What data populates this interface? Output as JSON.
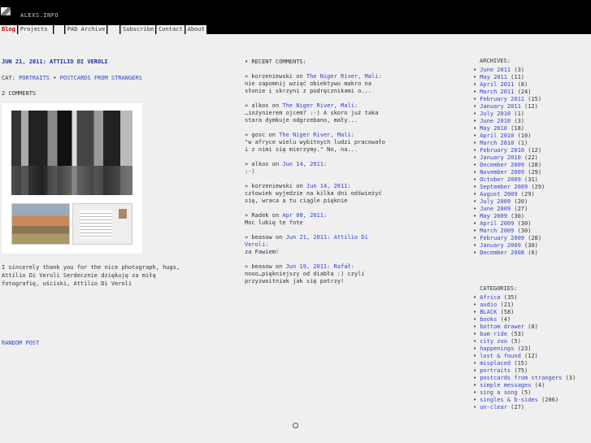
{
  "site": {
    "title": "ALEXS.INFO"
  },
  "nav": {
    "items": [
      "Blog",
      "Projects ",
      "",
      "PAD Archive",
      "",
      "Subscribe",
      "Contact",
      "About"
    ]
  },
  "post": {
    "title": "JUN 21, 2011: ATTILIO DI VEROLI",
    "cat_label": "CAT:",
    "cat1": "PORTRAITS",
    "cat_sep": "•",
    "cat2": "POSTCARDS FROM STRANGERS",
    "comments": "2 COMMENTS",
    "text": "I sincerely thank you for the nice photograph, hugs, Attilio Di Veroli Serdecznie dziękuję za miłą fotografię, uściski, Attilio Di Veroli",
    "random": "RANDOM POST"
  },
  "recent": {
    "heading": "• RECENT COMMENTS:",
    "items": [
      {
        "author": "» korzeniewski",
        "on": " on ",
        "link": "The Niger River, Mali",
        "colon": ":",
        "text": "nie zapomnij wziąć obiektywu makro na słonie i skrzyni z podręcznikami o..."
      },
      {
        "author": "» alkos",
        "on": " on ",
        "link": "The Niger River, Mali",
        "colon": ":",
        "text": "…inżynierem ojcem? :-) A skoro już taka stara dymkuje odgrzebano, mały..."
      },
      {
        "author": "» gosc",
        "on": " on ",
        "link": "The Niger River, Mali",
        "colon": ":",
        "text": "\"w afryce wielu wybitnych ludzi pracowało i z nimi się mierzymy.\" No, na..."
      },
      {
        "author": "» alkos",
        "on": " on ",
        "link": "Jun 14, 2011",
        "colon": ":",
        "text": ":-)"
      },
      {
        "author": "» korzeniewski",
        "on": " on ",
        "link": "Jun 14, 2011",
        "colon": ":",
        "text": "człowiek wyjedzie na kilka dni odświeżyć się, wraca a tu ciągle pięknie"
      },
      {
        "author": "» Radek",
        "on": " on ",
        "link": "Apr 08, 2011",
        "colon": ":",
        "text": "Moc lubię te fote"
      },
      {
        "author": "» beasow",
        "on": " on ",
        "link": "Jun 21, 2011: Attilio Di Veroli",
        "colon": ":",
        "text": "za Fawiem!"
      },
      {
        "author": "» beasow",
        "on": " on ",
        "link": "Jun 19, 2011: Rafał",
        "colon": ":",
        "text": "nooo…piękniejszy od diabła :) czyli przyzwoitniak jak się patrzy!"
      }
    ]
  },
  "archives": {
    "heading": "ARCHIVES:",
    "items": [
      {
        "label": "June 2011",
        "count": "(3)"
      },
      {
        "label": "May 2011",
        "count": "(11)"
      },
      {
        "label": "April 2011",
        "count": "(8)"
      },
      {
        "label": "March 2011",
        "count": "(24)"
      },
      {
        "label": "February 2011",
        "count": "(15)"
      },
      {
        "label": "January 2011",
        "count": "(12)"
      },
      {
        "label": "July 2010",
        "count": "(1)"
      },
      {
        "label": "June 2010",
        "count": "(3)"
      },
      {
        "label": "May 2010",
        "count": "(18)"
      },
      {
        "label": "April 2010",
        "count": "(10)"
      },
      {
        "label": "March 2010",
        "count": "(1)"
      },
      {
        "label": "February 2010",
        "count": "(12)"
      },
      {
        "label": "January 2010",
        "count": "(22)"
      },
      {
        "label": "December 2009",
        "count": "(28)"
      },
      {
        "label": "November 2009",
        "count": "(29)"
      },
      {
        "label": "October 2009",
        "count": "(31)"
      },
      {
        "label": "September 2009",
        "count": "(29)"
      },
      {
        "label": "August 2009",
        "count": "(29)"
      },
      {
        "label": "July 2009",
        "count": "(20)"
      },
      {
        "label": "June 2009",
        "count": "(27)"
      },
      {
        "label": "May 2009",
        "count": "(30)"
      },
      {
        "label": "April 2009",
        "count": "(30)"
      },
      {
        "label": "March 2009",
        "count": "(30)"
      },
      {
        "label": "February 2009",
        "count": "(28)"
      },
      {
        "label": "January 2009",
        "count": "(30)"
      },
      {
        "label": "December 2008",
        "count": "(6)"
      }
    ]
  },
  "categories": {
    "heading": "CATEGORIES:",
    "items": [
      {
        "label": "Africa",
        "count": "(35)"
      },
      {
        "label": "audio",
        "count": "(21)"
      },
      {
        "label": "BLACK",
        "count": "(58)"
      },
      {
        "label": "books",
        "count": "(4)"
      },
      {
        "label": "bottom drawer",
        "count": "(8)"
      },
      {
        "label": "bum ride",
        "count": "(53)"
      },
      {
        "label": "city zoo",
        "count": "(5)"
      },
      {
        "label": "happenings",
        "count": "(23)"
      },
      {
        "label": "lost & found",
        "count": "(12)"
      },
      {
        "label": "misplaced",
        "count": "(15)"
      },
      {
        "label": "portraits",
        "count": "(75)"
      },
      {
        "label": "postcards from strangers",
        "count": "(3)"
      },
      {
        "label": "simple messages",
        "count": "(4)"
      },
      {
        "label": "sing a song",
        "count": "(5)"
      },
      {
        "label": "singles & b-sides",
        "count": "(206)"
      },
      {
        "label": "un-clear",
        "count": "(27)"
      }
    ]
  }
}
